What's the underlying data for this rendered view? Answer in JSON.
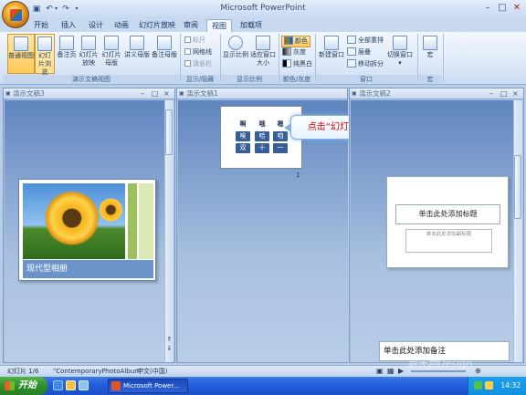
{
  "window": {
    "title": "Microsoft PowerPoint"
  },
  "tabs": [
    {
      "label": "开始"
    },
    {
      "label": "插入"
    },
    {
      "label": "设计"
    },
    {
      "label": "动画"
    },
    {
      "label": "幻灯片放映"
    },
    {
      "label": "审阅"
    },
    {
      "label": "视图"
    },
    {
      "label": "加载项"
    }
  ],
  "active_tab": "视图",
  "ribbon": {
    "views": {
      "normal": "普通视图",
      "slide_browse": "幻灯片浏览",
      "notes_page": "备注页",
      "slideshow": "幻灯片放映",
      "slide_master": "幻灯片母版",
      "handout_master": "讲义母版",
      "notes_master": "备注母版",
      "group_label": "演示文稿视图"
    },
    "show_hide": {
      "ruler": "标尺",
      "gridlines": "网格线",
      "message_bar": "消息栏",
      "group_label": "显示/隐藏"
    },
    "zoom": {
      "zoom": "显示比例",
      "fit": "适应窗口大小",
      "group_label": "显示比例"
    },
    "color": {
      "color": "颜色",
      "grayscale": "灰度",
      "bw": "纯黑白",
      "group_label": "颜色/灰度"
    },
    "window": {
      "new_window": "新建窗口",
      "arrange_all": "全部重排",
      "cascade": "层叠",
      "move_split": "移动拆分",
      "switch": "切换窗口",
      "group_label": "窗口"
    },
    "macro": {
      "macro": "宏",
      "group_label": "宏"
    }
  },
  "panes": {
    "left": {
      "title": "演示文稿3",
      "thumb_caption": "现代型相册"
    },
    "middle": {
      "title": "演示文稿1",
      "slide_number": "1",
      "glyphs_top": [
        "啊",
        "哦",
        "嗯"
      ],
      "glyphs": [
        "唉",
        "哈",
        "咱",
        "双",
        "十",
        "一"
      ],
      "callout": "点击“幻灯片浏览”"
    },
    "right": {
      "title": "演示文稿2",
      "title_placeholder": "单击此处添加标题",
      "subtitle_placeholder": "单击此处添加副标题",
      "notes": "单击此处添加备注"
    }
  },
  "status": {
    "slide": "幻灯片 1/6",
    "theme": "\"ContemporaryPhotoAlbum\"",
    "lang": "中文(中国)"
  },
  "taskbar": {
    "start": "开始",
    "item": "Microsoft Power...",
    "clock": "14:32"
  },
  "watermark": "新天地Design"
}
